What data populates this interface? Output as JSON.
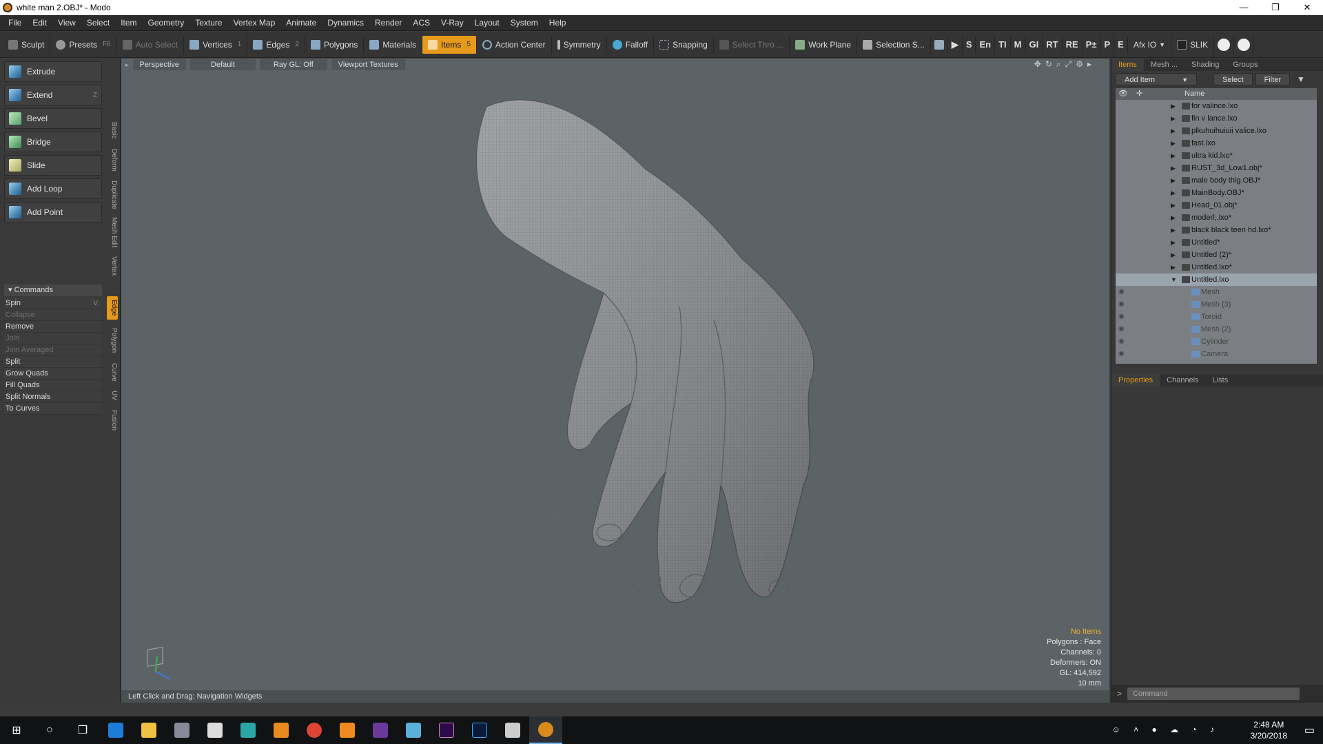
{
  "window": {
    "title": "white man 2.OBJ* - Modo",
    "min": "—",
    "max": "❐",
    "close": "✕"
  },
  "menu": [
    "File",
    "Edit",
    "View",
    "Select",
    "Item",
    "Geometry",
    "Texture",
    "Vertex Map",
    "Animate",
    "Dynamics",
    "Render",
    "ACS",
    "V-Ray",
    "Layout",
    "System",
    "Help"
  ],
  "toolbar": {
    "sculpt": "Sculpt",
    "presets": "Presets",
    "presets_key": "F6",
    "auto_select": "Auto Select",
    "vertices": "Vertices",
    "vertices_key": "1",
    "edges": "Edges",
    "edges_key": "2",
    "polygons": "Polygons",
    "materials": "Materials",
    "items": "Items",
    "items_key": "5",
    "action_center": "Action Center",
    "symmetry": "Symmetry",
    "falloff": "Falloff",
    "snapping": "Snapping",
    "select_thru": "Select Thro ...",
    "work_plane": "Work Plane",
    "selection_sets": "Selection S...",
    "small": [
      "S",
      "En",
      "TI",
      "M",
      "GI",
      "RT",
      "RE",
      "P±",
      "P",
      "E"
    ],
    "afx": "Afx IO",
    "slik": "SLIK"
  },
  "left": {
    "tools": [
      {
        "label": "Extrude",
        "key": ""
      },
      {
        "label": "Extend",
        "key": "Z"
      },
      {
        "label": "Bevel",
        "key": ""
      },
      {
        "label": "Bridge",
        "key": ""
      },
      {
        "label": "Slide",
        "key": ""
      },
      {
        "label": "Add Loop",
        "key": ""
      },
      {
        "label": "Add Point",
        "key": ""
      }
    ],
    "commands_header": "Commands",
    "commands": [
      {
        "label": "Spin",
        "key": "V",
        "disabled": false
      },
      {
        "label": "Collapse",
        "key": "",
        "disabled": true
      },
      {
        "label": "Remove",
        "key": "",
        "disabled": false
      },
      {
        "label": "Join",
        "key": "",
        "disabled": true
      },
      {
        "label": "Join Averaged",
        "key": "",
        "disabled": true
      },
      {
        "label": "Split",
        "key": "",
        "disabled": false
      },
      {
        "label": "Grow Quads",
        "key": "",
        "disabled": false
      },
      {
        "label": "Fill Quads",
        "key": "",
        "disabled": false
      },
      {
        "label": "Split Normals",
        "key": "",
        "disabled": false
      },
      {
        "label": "To Curves",
        "key": "",
        "disabled": false
      }
    ],
    "vtabs": [
      "Basic",
      "Deform",
      "Duplicate",
      "Mesh Edit",
      "Vertex",
      "Edge",
      "Polygon",
      "Curve",
      "UV",
      "Fusion"
    ]
  },
  "viewport": {
    "perspective": "Perspective",
    "default": "Default",
    "raygl": "Ray GL: Off",
    "textures": "Viewport Textures",
    "hud": {
      "no_items": "No Items",
      "polygons": "Polygons : Face",
      "channels": "Channels: 0",
      "deformers": "Deformers: ON",
      "gl": "GL: 414,592",
      "scale": "10 mm"
    },
    "status": "Left Click and Drag:    Navigation Widgets"
  },
  "right": {
    "tabs": [
      "Items",
      "Mesh ...",
      "Shading",
      "Groups"
    ],
    "add_item": "Add Item",
    "select": "Select",
    "filter": "Filter",
    "name_col": "Name",
    "items": [
      {
        "label": "for valince.lxo",
        "child": false
      },
      {
        "label": "fin v lance.lxo",
        "child": false
      },
      {
        "label": "plkuhuihuiuii valice.lxo",
        "child": false
      },
      {
        "label": "fast.lxo",
        "child": false
      },
      {
        "label": "ultra kid.lxo*",
        "child": false
      },
      {
        "label": "RUST_3d_Low1.obj*",
        "child": false
      },
      {
        "label": "male body thig.OBJ*",
        "child": false
      },
      {
        "label": "MainBody.OBJ*",
        "child": false
      },
      {
        "label": "Head_01.obj*",
        "child": false
      },
      {
        "label": "moderl;.lxo*",
        "child": false
      },
      {
        "label": "black black teen hd.lxo*",
        "child": false
      },
      {
        "label": "Untitled*",
        "child": false
      },
      {
        "label": "Untitled (2)*",
        "child": false
      },
      {
        "label": "Untitled.lxo*",
        "child": false
      },
      {
        "label": "Untitled.lxo",
        "child": false
      },
      {
        "label": "Mesh",
        "child": true
      },
      {
        "label": "Mesh (3)",
        "child": true
      },
      {
        "label": "Toroid",
        "child": true
      },
      {
        "label": "Mesh (2)",
        "child": true
      },
      {
        "label": "Cylinder",
        "child": true
      },
      {
        "label": "Camera",
        "child": true
      }
    ],
    "prop_tabs": [
      "Properties",
      "Channels",
      "Lists"
    ],
    "command_placeholder": "Command"
  },
  "taskbar": {
    "time": "2:48 AM",
    "date": "3/20/2018"
  }
}
